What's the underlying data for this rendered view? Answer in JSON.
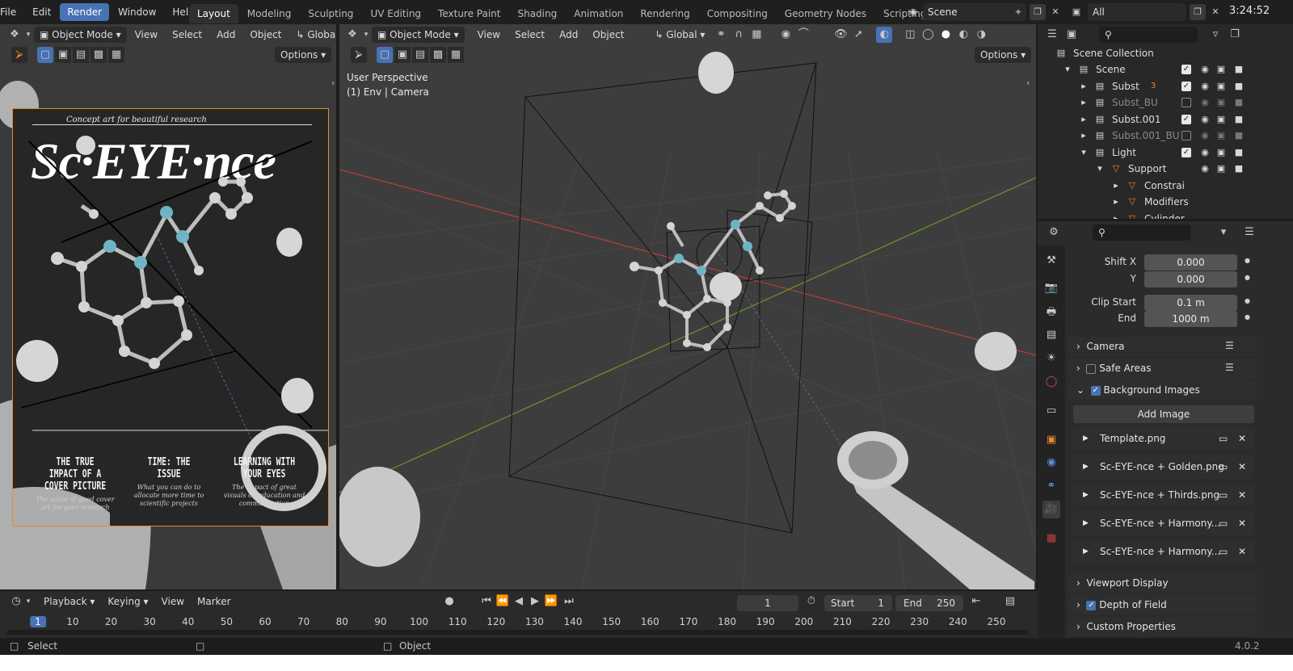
{
  "topbar": {
    "menus": [
      "File",
      "Edit",
      "Render",
      "Window",
      "Help"
    ],
    "active_menu": "Render",
    "workspaces": [
      "Layout",
      "Modeling",
      "Sculpting",
      "UV Editing",
      "Texture Paint",
      "Shading",
      "Animation",
      "Rendering",
      "Compositing",
      "Geometry Nodes",
      "Scripting"
    ],
    "active_workspace": "Layout",
    "add_workspace": "+",
    "scene_name": "Scene",
    "view_layer": "All",
    "clock": "3:24:52"
  },
  "left_editor": {
    "mode": "Object Mode",
    "menus": [
      "View",
      "Select",
      "Add",
      "Object"
    ],
    "orientation": "Globa",
    "options": "Options"
  },
  "poster": {
    "tagline": "Concept art for beautiful research",
    "title": "Sc·EYE·nce",
    "columns": [
      {
        "heading": "The true impact of a cover picture",
        "sub": "The value of good cover art for your research"
      },
      {
        "heading": "Time: the issue",
        "sub": "What you can do to allocate more time to scientific projects"
      },
      {
        "heading": "Learning with your eyes",
        "sub": "The impact of great visuals on education and communication"
      }
    ]
  },
  "viewport": {
    "mode": "Object Mode",
    "menus": [
      "View",
      "Select",
      "Add",
      "Object"
    ],
    "orientation": "Global",
    "options": "Options",
    "perspective": "User Perspective",
    "context": "(1) Env | Camera"
  },
  "outliner": {
    "root": "Scene Collection",
    "rows": [
      {
        "name": "Scene",
        "depth": 1,
        "open": true,
        "visible": true
      },
      {
        "name": "Subst",
        "depth": 2,
        "open": false,
        "visible": true,
        "badge": "3"
      },
      {
        "name": "Subst_BU",
        "depth": 2,
        "open": false,
        "visible": false
      },
      {
        "name": "Subst.001",
        "depth": 2,
        "open": false,
        "visible": true
      },
      {
        "name": "Subst.001_BU",
        "depth": 2,
        "open": false,
        "visible": false
      },
      {
        "name": "Light",
        "depth": 2,
        "open": true,
        "visible": true
      },
      {
        "name": "Support",
        "depth": 3,
        "open": true,
        "visible": true
      },
      {
        "name": "Constrai",
        "depth": 4,
        "open": false,
        "visible": true
      },
      {
        "name": "Modifiers",
        "depth": 4,
        "open": false,
        "visible": true
      },
      {
        "name": "Cylinder",
        "depth": 4,
        "open": false,
        "visible": true
      }
    ]
  },
  "properties": {
    "shift_x_label": "Shift X",
    "shift_x": "0.000",
    "shift_y_label": "Y",
    "shift_y": "0.000",
    "clip_start_label": "Clip Start",
    "clip_start": "0.1 m",
    "clip_end_label": "End",
    "clip_end": "1000 m",
    "panels": {
      "camera": "Camera",
      "safe_areas": "Safe Areas",
      "background_images": "Background Images",
      "add_image": "Add Image",
      "viewport_display": "Viewport Display",
      "depth_of_field": "Depth of Field",
      "custom_properties": "Custom Properties"
    },
    "background_images": [
      "Template.png",
      "Sc-EYE-nce + Golden.png",
      "Sc-EYE-nce + Thirds.png",
      "Sc-EYE-nce + Harmony...",
      "Sc-EYE-nce + Harmony..."
    ]
  },
  "timeline": {
    "menus": [
      "Playback",
      "Keying",
      "View",
      "Marker"
    ],
    "current_frame": "1",
    "start_label": "Start",
    "start": "1",
    "end_label": "End",
    "end": "250",
    "ticks": [
      "1",
      "10",
      "20",
      "30",
      "40",
      "50",
      "60",
      "70",
      "80",
      "90",
      "100",
      "110",
      "120",
      "130",
      "140",
      "150",
      "160",
      "170",
      "180",
      "190",
      "200",
      "210",
      "220",
      "230",
      "240",
      "250"
    ]
  },
  "statusbar": {
    "left": "Select",
    "middle": "Object",
    "version": "4.0.2"
  },
  "colors": {
    "accent": "#4772b3",
    "poster_frame": "#e8892c",
    "x_axis": "#b4403c",
    "y_axis": "#6a9a2a",
    "atom_blue": "#6fb4c4"
  }
}
